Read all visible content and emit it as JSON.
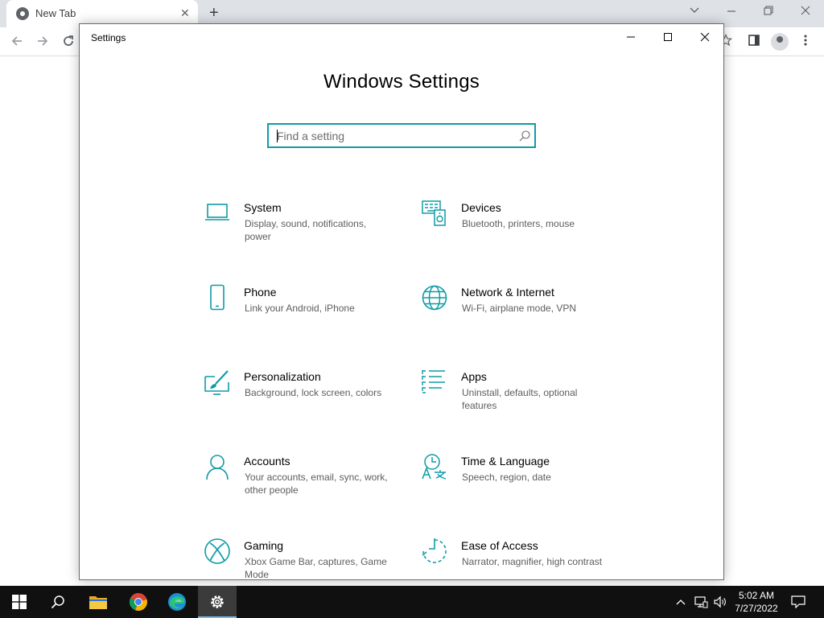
{
  "browser": {
    "tab_title": "New Tab",
    "tab_close": "✕",
    "new_tab": "+"
  },
  "window": {
    "title": "Settings",
    "page_title": "Windows Settings",
    "search_placeholder": "Find a setting"
  },
  "settings": [
    {
      "name": "System",
      "desc": "Display, sound, notifications, power",
      "icon": "laptop-icon"
    },
    {
      "name": "Devices",
      "desc": "Bluetooth, printers, mouse",
      "icon": "devices-icon"
    },
    {
      "name": "Phone",
      "desc": "Link your Android, iPhone",
      "icon": "phone-icon"
    },
    {
      "name": "Network & Internet",
      "desc": "Wi-Fi, airplane mode, VPN",
      "icon": "globe-icon"
    },
    {
      "name": "Personalization",
      "desc": "Background, lock screen, colors",
      "icon": "paintbrush-icon"
    },
    {
      "name": "Apps",
      "desc": "Uninstall, defaults, optional features",
      "icon": "apps-list-icon"
    },
    {
      "name": "Accounts",
      "desc": "Your accounts, email, sync, work, other people",
      "icon": "person-icon"
    },
    {
      "name": "Time & Language",
      "desc": "Speech, region, date",
      "icon": "time-language-icon"
    },
    {
      "name": "Gaming",
      "desc": "Xbox Game Bar, captures, Game Mode",
      "icon": "xbox-icon"
    },
    {
      "name": "Ease of Access",
      "desc": "Narrator, magnifier, high contrast",
      "icon": "ease-of-access-icon"
    }
  ],
  "taskbar": {
    "time": "5:02 AM",
    "date": "7/27/2022"
  },
  "colors": {
    "accent": "#0f9ca6",
    "taskbar": "#101010"
  }
}
